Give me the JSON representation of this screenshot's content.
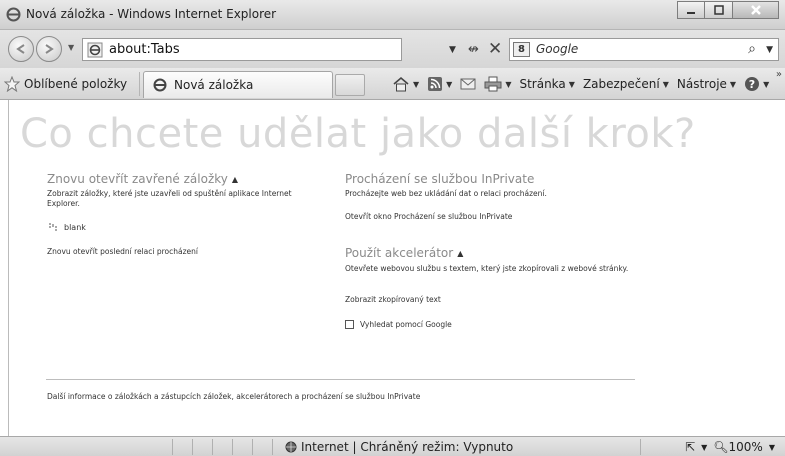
{
  "window": {
    "title": "Nová záložka - Windows Internet Explorer"
  },
  "address_bar": {
    "url": "about:Tabs"
  },
  "search": {
    "placeholder": "Google",
    "provider_icon_text": "8"
  },
  "toolbar": {
    "favorites_label": "Oblíbené položky",
    "tab_label": "Nová záložka",
    "page_menu": "Stránka",
    "safety_menu": "Zabezpečení",
    "tools_menu": "Nástroje",
    "more_chevron": "»"
  },
  "main": {
    "headline": "Co chcete udělat jako další krok?",
    "reopen_section": {
      "title": "Znovu otevřít zavřené záložky",
      "description": "Zobrazit záložky, které jste uzavřeli od spuštění aplikace Internet Explorer.",
      "closed_tab": "blank",
      "reopen_session_link": "Znovu otevřít poslední relaci procházení"
    },
    "inprivate_section": {
      "title": "Procházení se službou InPrivate",
      "description": "Procházejte web bez ukládání dat o relaci procházení.",
      "open_link": "Otevřít okno Procházení se službou InPrivate"
    },
    "accelerator_section": {
      "title": "Použít akcelerátor",
      "description": "Otevřete webovou službu s textem, který jste zkopírovali z webové stránky.",
      "show_copied_link": "Zobrazit zkopírovaný text",
      "search_link": "Vyhledat pomocí Google"
    },
    "footer_link": "Další informace o záložkách a zástupcích záložek, akcelerátorech a procházení se službou InPrivate"
  },
  "status_bar": {
    "zone_text": "Internet | Chráněný režim: Vypnuto",
    "zoom": "100%"
  },
  "colors": {
    "headline": "#d8d8d8",
    "section_title": "#8a8a8a"
  }
}
